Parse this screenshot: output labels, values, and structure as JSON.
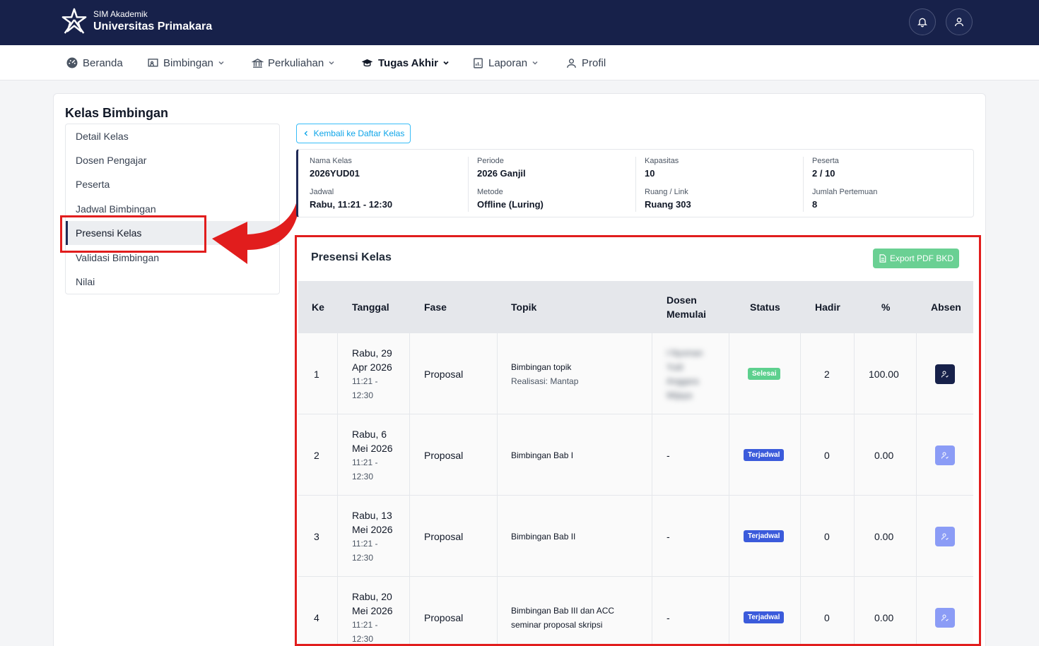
{
  "app": {
    "subtitle": "SIM Akademik",
    "title": "Universitas Primakara"
  },
  "nav": {
    "beranda": "Beranda",
    "bimbingan": "Bimbingan",
    "perkuliahan": "Perkuliahan",
    "tugas_akhir": "Tugas Akhir",
    "laporan": "Laporan",
    "profil": "Profil"
  },
  "page": {
    "title": "Kelas Bimbingan"
  },
  "sidebar": {
    "items": [
      {
        "label": "Detail Kelas"
      },
      {
        "label": "Dosen Pengajar"
      },
      {
        "label": "Peserta"
      },
      {
        "label": "Jadwal Bimbingan"
      },
      {
        "label": "Presensi Kelas"
      },
      {
        "label": "Validasi Bimbingan"
      },
      {
        "label": "Nilai"
      }
    ],
    "active": "Presensi Kelas"
  },
  "back_button": "Kembali ke Daftar Kelas",
  "info": {
    "nama_kelas": {
      "label": "Nama Kelas",
      "value": "2026YUD01"
    },
    "periode": {
      "label": "Periode",
      "value": "2026 Ganjil"
    },
    "kapasitas": {
      "label": "Kapasitas",
      "value": "10"
    },
    "peserta": {
      "label": "Peserta",
      "value": "2 / 10"
    },
    "jadwal": {
      "label": "Jadwal",
      "value": "Rabu, 11:21 - 12:30"
    },
    "metode": {
      "label": "Metode",
      "value": "Offline (Luring)"
    },
    "ruang": {
      "label": "Ruang / Link",
      "value": "Ruang 303"
    },
    "pertemuan": {
      "label": "Jumlah Pertemuan",
      "value": "8"
    }
  },
  "presensi": {
    "title": "Presensi Kelas",
    "export_label": "Export PDF BKD",
    "headers": {
      "ke": "Ke",
      "tanggal": "Tanggal",
      "fase": "Fase",
      "topik": "Topik",
      "dosen_1": "Dosen",
      "dosen_2": "Memulai",
      "status": "Status",
      "hadir": "Hadir",
      "persen": "%",
      "absen": "Absen"
    },
    "rows": [
      {
        "ke": "1",
        "date_1": "Rabu, 29",
        "date_2": "Apr 2026",
        "time_1": "11:21 -",
        "time_2": "12:30",
        "fase": "Proposal",
        "topik": "Bimbingan topik",
        "topik_sub": "Realisasi: Mantap",
        "dosen": "I Nyoman Yudi Anggara Wijaya",
        "status": "Selesai",
        "hadir": "2",
        "persen": "100.00"
      },
      {
        "ke": "2",
        "date_1": "Rabu, 6",
        "date_2": "Mei 2026",
        "time_1": "11:21 -",
        "time_2": "12:30",
        "fase": "Proposal",
        "topik": "Bimbingan Bab I",
        "topik_sub": "",
        "dosen": "-",
        "status": "Terjadwal",
        "hadir": "0",
        "persen": "0.00"
      },
      {
        "ke": "3",
        "date_1": "Rabu, 13",
        "date_2": "Mei 2026",
        "time_1": "11:21 -",
        "time_2": "12:30",
        "fase": "Proposal",
        "topik": "Bimbingan Bab II",
        "topik_sub": "",
        "dosen": "-",
        "status": "Terjadwal",
        "hadir": "0",
        "persen": "0.00"
      },
      {
        "ke": "4",
        "date_1": "Rabu, 20",
        "date_2": "Mei 2026",
        "time_1": "11:21 -",
        "time_2": "12:30",
        "fase": "Proposal",
        "topik": "Bimbingan Bab III dan ACC",
        "topik_sub": "seminar proposal skripsi",
        "dosen": "-",
        "status": "Terjadwal",
        "hadir": "0",
        "persen": "0.00"
      }
    ]
  },
  "colors": {
    "navy": "#17214a",
    "highlight": "#e11d1d",
    "success": "#5dd08e",
    "scheduled": "#3b5bdb",
    "export": "#6ad093"
  }
}
